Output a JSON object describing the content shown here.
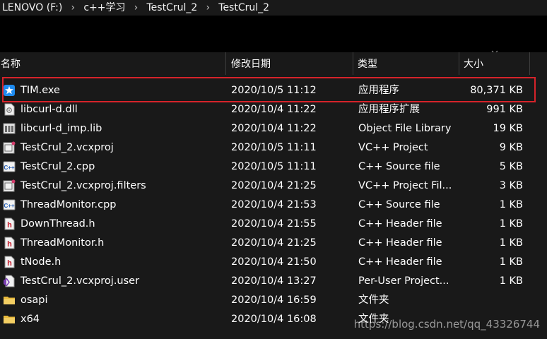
{
  "breadcrumb": [
    "LENOVO (F:)",
    "c++学习",
    "TestCrul_2",
    "TestCrul_2"
  ],
  "columns": {
    "name": "名称",
    "date": "修改日期",
    "type": "类型",
    "size": "大小"
  },
  "files": [
    {
      "name": "TIM.exe",
      "date": "2020/10/5 11:12",
      "type": "应用程序",
      "size": "80,371 KB",
      "icon": "tim-app-icon"
    },
    {
      "name": "libcurl-d.dll",
      "date": "2020/10/4 11:22",
      "type": "应用程序扩展",
      "size": "991 KB",
      "icon": "dll-file-icon"
    },
    {
      "name": "libcurl-d_imp.lib",
      "date": "2020/10/4 11:22",
      "type": "Object File Library",
      "size": "19 KB",
      "icon": "lib-file-icon"
    },
    {
      "name": "TestCrul_2.vcxproj",
      "date": "2020/10/5 11:11",
      "type": "VC++ Project",
      "size": "9 KB",
      "icon": "vcxproj-file-icon"
    },
    {
      "name": "TestCrul_2.cpp",
      "date": "2020/10/5 11:11",
      "type": "C++ Source file",
      "size": "5 KB",
      "icon": "cpp-file-icon"
    },
    {
      "name": "TestCrul_2.vcxproj.filters",
      "date": "2020/10/4 21:25",
      "type": "VC++ Project Fil...",
      "size": "3 KB",
      "icon": "vcxproj-file-icon"
    },
    {
      "name": "ThreadMonitor.cpp",
      "date": "2020/10/4 21:53",
      "type": "C++ Source file",
      "size": "1 KB",
      "icon": "cpp-file-icon"
    },
    {
      "name": "DownThread.h",
      "date": "2020/10/4 21:55",
      "type": "C++ Header file",
      "size": "1 KB",
      "icon": "header-file-icon"
    },
    {
      "name": "ThreadMonitor.h",
      "date": "2020/10/4 21:25",
      "type": "C++ Header file",
      "size": "1 KB",
      "icon": "header-file-icon"
    },
    {
      "name": "tNode.h",
      "date": "2020/10/4 21:50",
      "type": "C++ Header file",
      "size": "1 KB",
      "icon": "header-file-icon"
    },
    {
      "name": "TestCrul_2.vcxproj.user",
      "date": "2020/10/4 13:27",
      "type": "Per-User Project...",
      "size": "1 KB",
      "icon": "user-project-file-icon"
    },
    {
      "name": "osapi",
      "date": "2020/10/4 16:59",
      "type": "文件夹",
      "size": "",
      "icon": "folder-icon"
    },
    {
      "name": "x64",
      "date": "2020/10/4 16:08",
      "type": "文件夹",
      "size": "",
      "icon": "folder-icon"
    }
  ],
  "watermark": "https://blog.csdn.net/qq_43326744",
  "colors": {
    "background": "#191919",
    "toolbar_band": "#000000",
    "highlight_border": "#d6232a"
  }
}
